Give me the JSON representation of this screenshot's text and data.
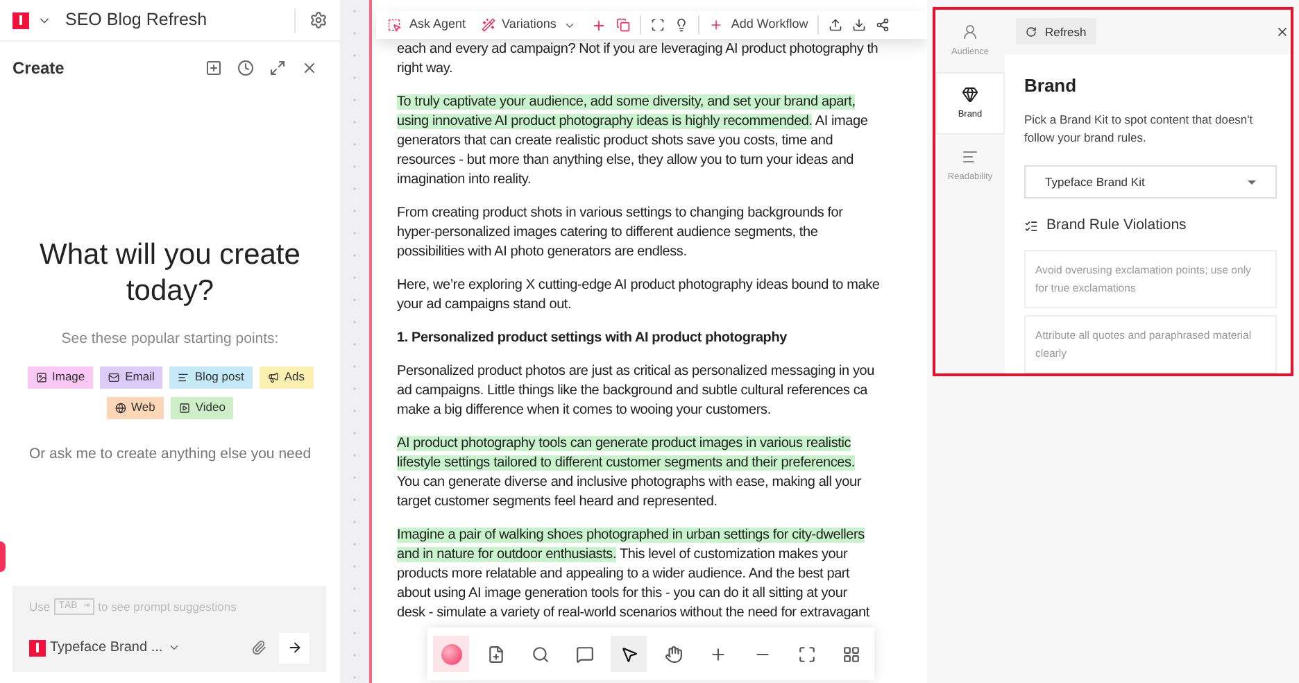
{
  "left_panel": {
    "project_title": "SEO Blog Refresh",
    "section_title": "Create",
    "heading": "What will you create today?",
    "subheading": "See these popular starting points:",
    "chips": [
      {
        "label": "Image",
        "color": "#f9c8f5"
      },
      {
        "label": "Email",
        "color": "#dccbf7"
      },
      {
        "label": "Blog post",
        "color": "#c5e9f7"
      },
      {
        "label": "Ads",
        "color": "#fbf0b0"
      },
      {
        "label": "Web",
        "color": "#fbd7b8"
      },
      {
        "label": "Video",
        "color": "#cdeec6"
      }
    ],
    "prompt_hint": "Or ask me to create anything else you need",
    "input": {
      "hint_before": "Use",
      "key": "TAB ⇥",
      "hint_after": "to see prompt suggestions",
      "brand_kit": "Typeface Brand ..."
    }
  },
  "doc_toolbar": {
    "ask_agent": "Ask Agent",
    "variations": "Variations",
    "add_workflow": "Add Workflow"
  },
  "document": {
    "blocks": [
      {
        "kind": "para",
        "lines": [
          [
            {
              "text": "each and every ad campaign? Not if you are leveraging AI product photography th",
              "highlighted": false
            }
          ],
          [
            {
              "text": "right way.",
              "highlighted": false
            }
          ]
        ]
      },
      {
        "kind": "para",
        "lines": [
          [
            {
              "text": "To truly captivate your audience, add some diversity, and set your brand apart,",
              "highlighted": true
            }
          ],
          [
            {
              "text": "using innovative AI product photography ideas is highly recommended.",
              "highlighted": true
            },
            {
              "text": " AI image",
              "highlighted": false
            }
          ],
          [
            {
              "text": "generators that can create realistic product shots save you costs, time and",
              "highlighted": false
            }
          ],
          [
            {
              "text": "resources - but more than anything else, they allow you to turn your ideas and",
              "highlighted": false
            }
          ],
          [
            {
              "text": "imagination into reality.",
              "highlighted": false
            }
          ]
        ]
      },
      {
        "kind": "para",
        "lines": [
          [
            {
              "text": "From creating product shots in various settings to changing backgrounds for",
              "highlighted": false
            }
          ],
          [
            {
              "text": "hyper-personalized images catering to different audience segments, the",
              "highlighted": false
            }
          ],
          [
            {
              "text": "possibilities with AI photo generators are endless.",
              "highlighted": false
            }
          ]
        ]
      },
      {
        "kind": "para",
        "lines": [
          [
            {
              "text": "Here, we’re exploring X cutting-edge AI product photography ideas bound to make",
              "highlighted": false
            }
          ],
          [
            {
              "text": "your ad campaigns stand out.",
              "highlighted": false
            }
          ]
        ]
      },
      {
        "kind": "heading",
        "lines": [
          [
            {
              "text": "1. Personalized product settings with AI product photography",
              "highlighted": false
            }
          ]
        ]
      },
      {
        "kind": "para",
        "lines": [
          [
            {
              "text": "Personalized product photos are just as critical as personalized messaging in you",
              "highlighted": false
            }
          ],
          [
            {
              "text": "ad campaigns. Little things like the background and subtle cultural references ca",
              "highlighted": false
            }
          ],
          [
            {
              "text": "make a big difference when it comes to wooing your customers.",
              "highlighted": false
            }
          ]
        ]
      },
      {
        "kind": "para",
        "lines": [
          [
            {
              "text": "AI product photography tools can generate product images in various realistic",
              "highlighted": true
            }
          ],
          [
            {
              "text": "lifestyle settings tailored to different customer segments and their preferences.",
              "highlighted": true
            }
          ],
          [
            {
              "text": "You can generate diverse and inclusive photographs with ease, making all your",
              "highlighted": false
            }
          ],
          [
            {
              "text": "target customer segments feel heard and represented.",
              "highlighted": false
            }
          ]
        ]
      },
      {
        "kind": "para",
        "lines": [
          [
            {
              "text": "Imagine a pair of walking shoes photographed in urban settings for city-dwellers",
              "highlighted": true
            }
          ],
          [
            {
              "text": "and in nature for outdoor enthusiasts.",
              "highlighted": true
            },
            {
              "text": " This level of customization makes your",
              "highlighted": false
            }
          ],
          [
            {
              "text": "products more relatable and appealing to a wider audience. And the best part",
              "highlighted": false
            }
          ],
          [
            {
              "text": "about using AI image generation tools for this - you can do it all sitting at your",
              "highlighted": false
            }
          ],
          [
            {
              "text": "desk - simulate a variety of real-world scenarios without the need for extravagant",
              "highlighted": false
            }
          ]
        ]
      }
    ]
  },
  "bottom_toolbar": {
    "tools": [
      {
        "selected": false
      },
      {
        "selected": false
      },
      {
        "selected": false
      },
      {
        "selected": true
      },
      {
        "selected": false
      },
      {
        "selected": false
      },
      {
        "selected": false
      },
      {
        "selected": false
      },
      {
        "selected": false
      }
    ]
  },
  "right_panel": {
    "tabs": [
      {
        "label": "Audience",
        "selected": false
      },
      {
        "label": "Brand",
        "selected": true
      },
      {
        "label": "Readability",
        "selected": false
      }
    ],
    "refresh": "Refresh",
    "title": "Brand",
    "description": "Pick a Brand Kit to spot content that doesn't follow your brand rules.",
    "brand_kit": "Typeface Brand Kit",
    "violations_title": "Brand Rule Violations",
    "violations": [
      "Avoid overusing exclamation points; use only for true exclamations",
      "Attribute all quotes and paraphrased material clearly"
    ]
  }
}
